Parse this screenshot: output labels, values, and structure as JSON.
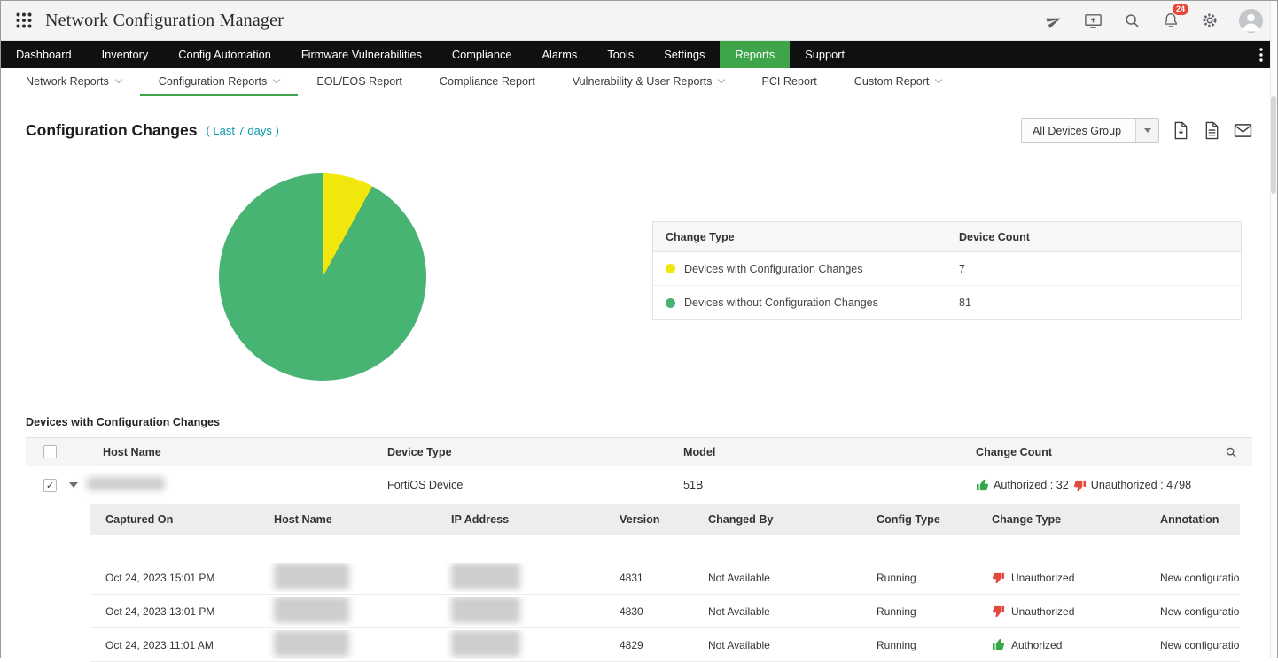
{
  "header": {
    "title": "Network Configuration Manager",
    "notification_count": "24",
    "icons": [
      "apps-grid",
      "send",
      "screen-share",
      "search",
      "notifications",
      "settings",
      "user-avatar"
    ]
  },
  "nav": {
    "items": [
      {
        "label": "Dashboard",
        "active": false
      },
      {
        "label": "Inventory",
        "active": false
      },
      {
        "label": "Config Automation",
        "active": false
      },
      {
        "label": "Firmware Vulnerabilities",
        "active": false
      },
      {
        "label": "Compliance",
        "active": false
      },
      {
        "label": "Alarms",
        "active": false
      },
      {
        "label": "Tools",
        "active": false
      },
      {
        "label": "Settings",
        "active": false
      },
      {
        "label": "Reports",
        "active": true
      },
      {
        "label": "Support",
        "active": false
      }
    ]
  },
  "subnav": {
    "items": [
      {
        "label": "Network Reports",
        "has_dropdown": true,
        "active": false
      },
      {
        "label": "Configuration Reports",
        "has_dropdown": true,
        "active": true
      },
      {
        "label": "EOL/EOS Report",
        "has_dropdown": false,
        "active": false
      },
      {
        "label": "Compliance Report",
        "has_dropdown": false,
        "active": false
      },
      {
        "label": "Vulnerability & User Reports",
        "has_dropdown": true,
        "active": false
      },
      {
        "label": "PCI Report",
        "has_dropdown": false,
        "active": false
      },
      {
        "label": "Custom Report",
        "has_dropdown": true,
        "active": false
      }
    ]
  },
  "page": {
    "title": "Configuration Changes",
    "period": "( Last 7 days )",
    "device_group_selector": "All Devices Group",
    "export_icons": [
      "pdf-export",
      "csv-export",
      "email-report"
    ]
  },
  "chart_data": {
    "type": "pie",
    "title": "Configuration Changes ( Last 7 days )",
    "labels": [
      "Devices with Configuration Changes",
      "Devices without Configuration Changes"
    ],
    "values": [
      7,
      81
    ],
    "colors": [
      "#f2e70d",
      "#48b474"
    ],
    "legend_position": "right-table"
  },
  "legend_table": {
    "headers": [
      "Change Type",
      "Device Count"
    ],
    "rows": [
      {
        "label": "Devices with Configuration Changes",
        "count": "7",
        "color": "#f2e70d"
      },
      {
        "label": "Devices without Configuration Changes",
        "count": "81",
        "color": "#48b474"
      }
    ]
  },
  "devices_table": {
    "title": "Devices with Configuration Changes",
    "headers": [
      "Host Name",
      "Device Type",
      "Model",
      "Change Count"
    ],
    "row": {
      "device_type": "FortiOS Device",
      "model": "51B",
      "authorized": "Authorized : 32",
      "unauthorized": "Unauthorized : 4798"
    },
    "detail_headers": [
      "Captured On",
      "Host Name",
      "IP Address",
      "Version",
      "Changed By",
      "Config Type",
      "Change Type",
      "Annotation"
    ],
    "detail_rows": [
      {
        "captured_on": "Oct 24, 2023 15:01 PM",
        "version": "4831",
        "changed_by": "Not Available",
        "config_type": "Running",
        "change_type": "Unauthorized",
        "authorized": false,
        "annotation": "New configuration"
      },
      {
        "captured_on": "Oct 24, 2023 13:01 PM",
        "version": "4830",
        "changed_by": "Not Available",
        "config_type": "Running",
        "change_type": "Unauthorized",
        "authorized": false,
        "annotation": "New configuration"
      },
      {
        "captured_on": "Oct 24, 2023 11:01 AM",
        "version": "4829",
        "changed_by": "Not Available",
        "config_type": "Running",
        "change_type": "Authorized",
        "authorized": true,
        "annotation": "New configuration"
      }
    ]
  },
  "colors": {
    "nav_active": "#3fa54b",
    "pie_yellow": "#f2e70d",
    "pie_green": "#48b474",
    "period_teal": "#0b9aab",
    "authorized_green": "#35a84c",
    "unauthorized_red": "#e2483d"
  }
}
